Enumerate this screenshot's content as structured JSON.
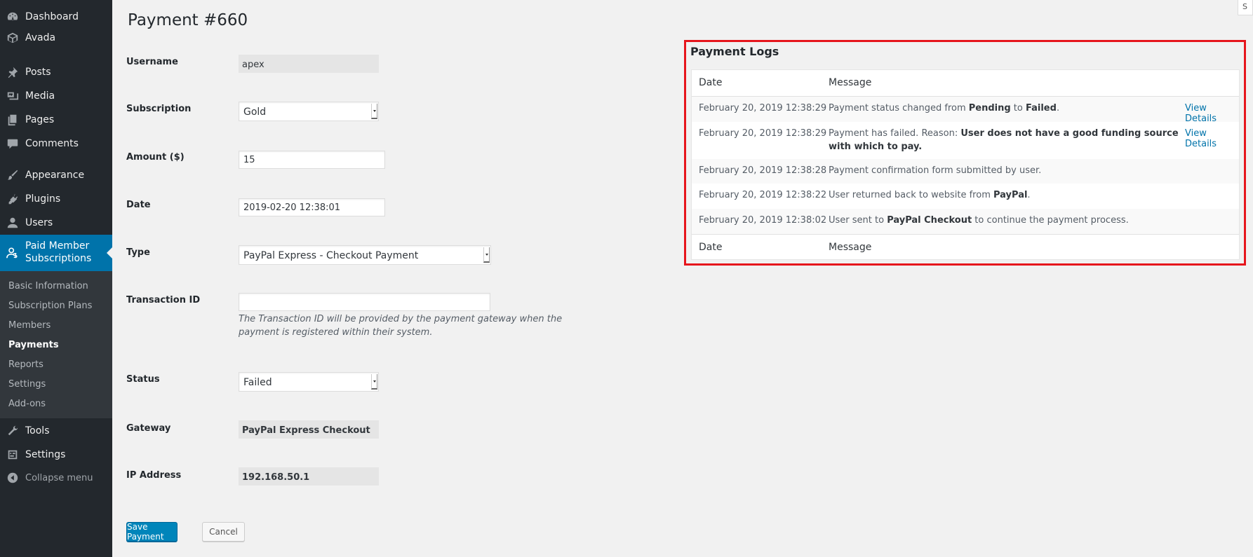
{
  "sidebar": {
    "menu": [
      {
        "label": "Dashboard",
        "icon": "dashboard-icon"
      },
      {
        "label": "Avada",
        "icon": "avada-icon"
      },
      {
        "label": "Posts",
        "icon": "pin-icon"
      },
      {
        "label": "Media",
        "icon": "media-icon"
      },
      {
        "label": "Pages",
        "icon": "pages-icon"
      },
      {
        "label": "Comments",
        "icon": "comment-icon"
      },
      {
        "label": "Appearance",
        "icon": "brush-icon"
      },
      {
        "label": "Plugins",
        "icon": "plugin-icon"
      },
      {
        "label": "Users",
        "icon": "user-icon"
      }
    ],
    "active_menu": {
      "line1": "Paid Member",
      "line2": "Subscriptions",
      "icon": "member-icon"
    },
    "submenu": [
      "Basic Information",
      "Subscription Plans",
      "Members",
      "Payments",
      "Reports",
      "Settings",
      "Add-ons"
    ],
    "submenu_current": "Payments",
    "bottom_menu": [
      {
        "label": "Tools",
        "icon": "wrench-icon"
      },
      {
        "label": "Settings",
        "icon": "settings-icon"
      }
    ],
    "collapse_label": "Collapse menu"
  },
  "screen_options_label": "S",
  "page": {
    "title": "Payment #660",
    "fields": {
      "username": {
        "label": "Username",
        "value": "apex"
      },
      "subscription": {
        "label": "Subscription",
        "value": "Gold"
      },
      "amount": {
        "label": "Amount ($)",
        "value": "15"
      },
      "date": {
        "label": "Date",
        "value": "2019-02-20 12:38:01"
      },
      "type": {
        "label": "Type",
        "value": "PayPal Express - Checkout Payment"
      },
      "transaction_id": {
        "label": "Transaction ID",
        "value": "",
        "description": "The Transaction ID will be provided by the payment gateway when the payment is registered within their system."
      },
      "status": {
        "label": "Status",
        "value": "Failed"
      },
      "gateway": {
        "label": "Gateway",
        "value": "PayPal Express Checkout"
      },
      "ip_address": {
        "label": "IP Address",
        "value": "192.168.50.1"
      }
    },
    "save_label": "Save Payment",
    "cancel_label": "Cancel"
  },
  "logs": {
    "title": "Payment Logs",
    "columns": [
      "Date",
      "Message"
    ],
    "view_details_label": "View Details",
    "rows": [
      {
        "date": "February 20, 2019 12:38:29",
        "parts": [
          "Payment status changed from ",
          "Pending",
          " to ",
          "Failed",
          "."
        ],
        "details": true
      },
      {
        "date": "February 20, 2019 12:38:29",
        "parts": [
          "Payment has failed. Reason: ",
          "User does not have a good funding source with which to pay."
        ],
        "details": true
      },
      {
        "date": "February 20, 2019 12:38:28",
        "parts": [
          "Payment confirmation form submitted by user."
        ],
        "details": false
      },
      {
        "date": "February 20, 2019 12:38:22",
        "parts": [
          "User returned back to website from ",
          "PayPal",
          "."
        ],
        "details": false
      },
      {
        "date": "February 20, 2019 12:38:02",
        "parts": [
          "User sent to ",
          "PayPal Checkout",
          " to continue the payment process."
        ],
        "details": false
      }
    ]
  },
  "colors": {
    "sidebar_bg": "#23282d",
    "active_menu_bg": "#0073aa",
    "primary_button": "#0085ba",
    "highlight_border": "#e6151c",
    "link": "#0073aa"
  }
}
